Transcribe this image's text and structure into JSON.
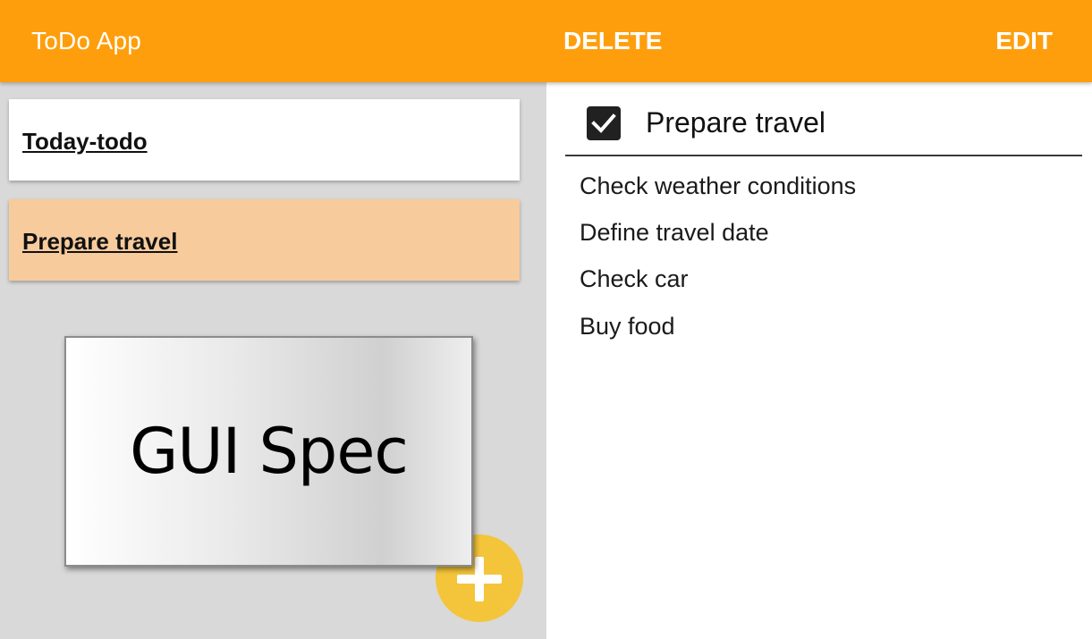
{
  "header": {
    "app_title": "ToDo App",
    "delete_label": "DELETE",
    "edit_label": "EDIT",
    "background_color": "#FF9E0C"
  },
  "sidebar": {
    "lists": [
      {
        "label": "Today-todo",
        "selected": false
      },
      {
        "label": "Prepare travel",
        "selected": true
      }
    ],
    "selected_color": "#F8CB9D",
    "add_button_icon": "plus-icon",
    "add_button_color": "#F4C53A"
  },
  "overlay": {
    "text": "GUI Spec"
  },
  "detail": {
    "title": "Prepare travel",
    "checked": true,
    "checkbox_icon": "checkmark-icon",
    "tasks": [
      "Check weather conditions",
      "Define travel date",
      "Check car",
      "Buy food"
    ]
  }
}
